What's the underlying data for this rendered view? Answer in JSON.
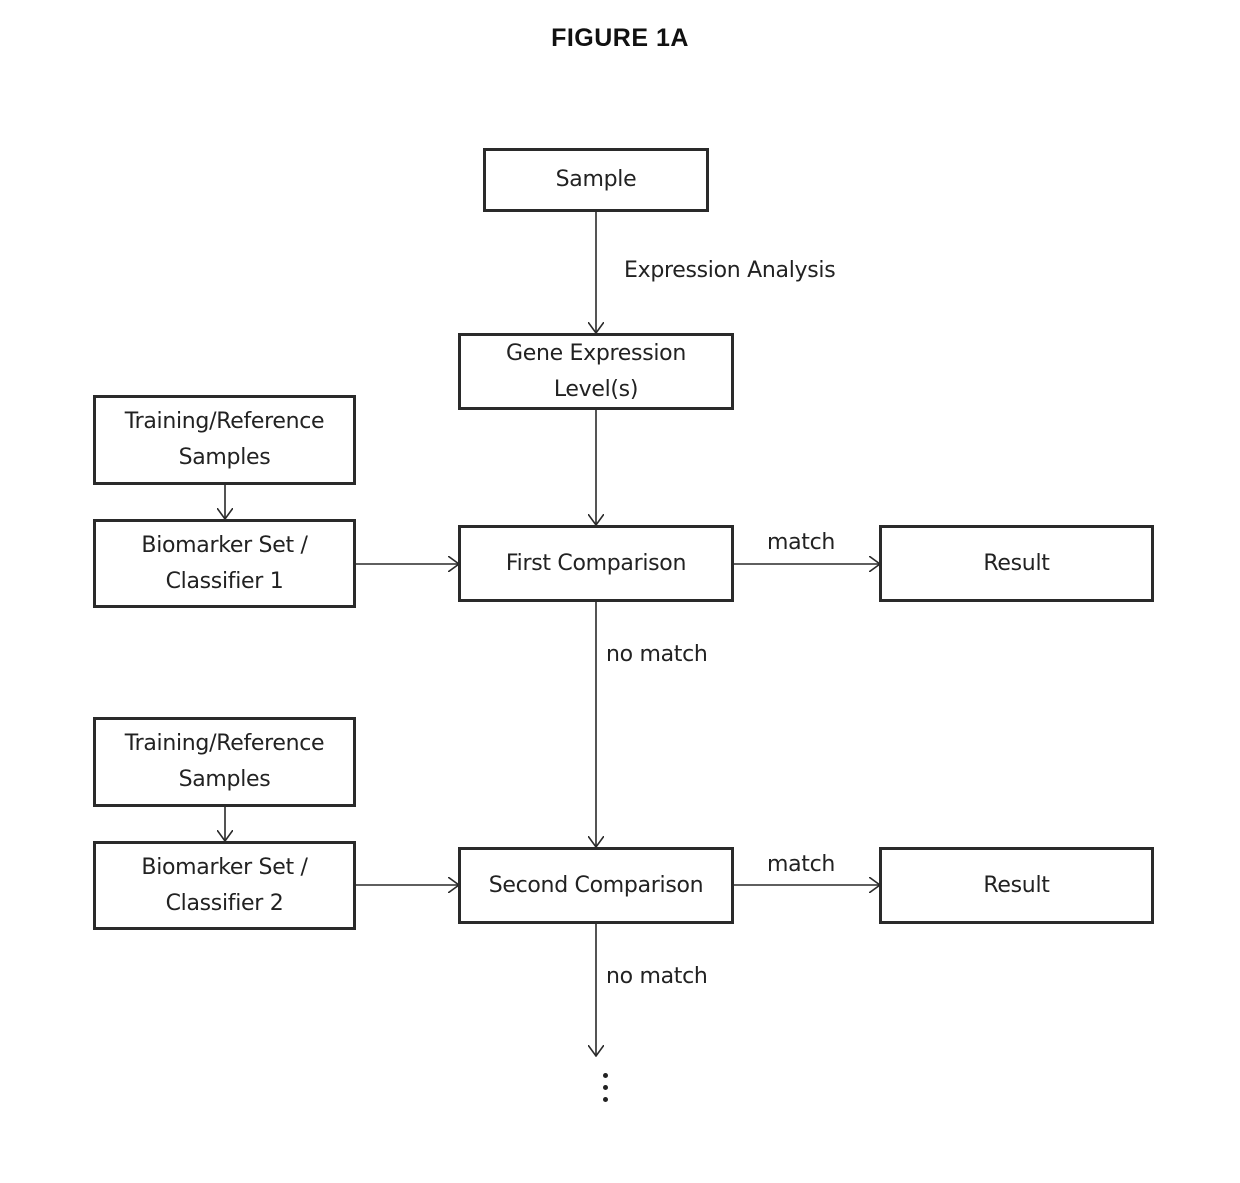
{
  "figure": {
    "title": "FIGURE 1A"
  },
  "nodes": {
    "sample": "Sample",
    "gene_expression": [
      "Gene Expression",
      "Level(s)"
    ],
    "training_1": [
      "Training/Reference",
      "Samples"
    ],
    "classifier_1": [
      "Biomarker Set /",
      "Classifier 1"
    ],
    "first_comparison": "First Comparison",
    "result_1": "Result",
    "training_2": [
      "Training/Reference",
      "Samples"
    ],
    "classifier_2": [
      "Biomarker Set /",
      "Classifier 2"
    ],
    "second_comparison": "Second Comparison",
    "result_2": "Result"
  },
  "edge_labels": {
    "expression_analysis": "Expression Analysis",
    "match_1": "match",
    "no_match_1": "no match",
    "match_2": "match",
    "no_match_2": "no match"
  },
  "continuation": "ellipsis-vertical"
}
